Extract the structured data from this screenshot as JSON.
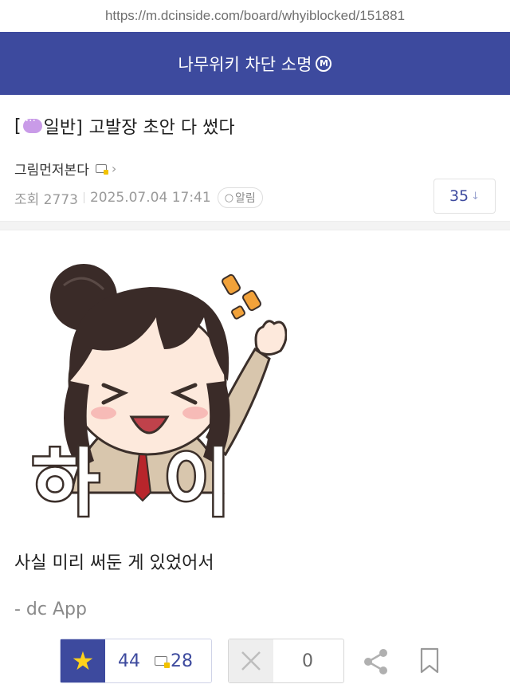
{
  "url": "https://m.dcinside.com/board/whyiblocked/151881",
  "board": {
    "title": "나무위키 차단 소명",
    "badge": "M"
  },
  "post": {
    "bracket_open": "[",
    "category": "일반]",
    "title": "고발장 초안 다 썼다",
    "author": "그림먼저본다",
    "views_label": "조회 2773",
    "date": "2025.07.04 17:41",
    "alarm_label": "알림",
    "comment_count": "35",
    "sticker_text": [
      "하",
      "이"
    ],
    "body": "사실 미리 써둔 게 있었어서",
    "signature": "- dc App"
  },
  "actions": {
    "recommend_count": "44",
    "fixed_recommend_count": "28",
    "downvote_count": "0"
  },
  "colors": {
    "brand": "#3d4a9e",
    "star": "#ffd21c",
    "hair": "#3a2b28",
    "skin": "#fde9dc",
    "cardigan": "#d8c6ad"
  }
}
